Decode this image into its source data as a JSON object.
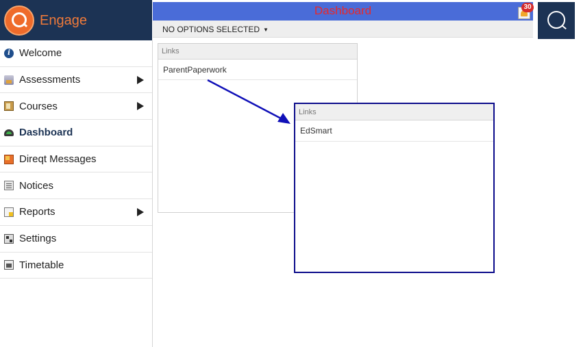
{
  "app": {
    "name": "Engage"
  },
  "sidebar": {
    "items": [
      {
        "label": "Welcome",
        "icon": "info-icon",
        "has_submenu": false,
        "active": false
      },
      {
        "label": "Assessments",
        "icon": "assessments-icon",
        "has_submenu": true,
        "active": false
      },
      {
        "label": "Courses",
        "icon": "courses-icon",
        "has_submenu": true,
        "active": false
      },
      {
        "label": "Dashboard",
        "icon": "dashboard-icon",
        "has_submenu": false,
        "active": true
      },
      {
        "label": "Direqt Messages",
        "icon": "messages-icon",
        "has_submenu": false,
        "active": false
      },
      {
        "label": "Notices",
        "icon": "notices-icon",
        "has_submenu": false,
        "active": false
      },
      {
        "label": "Reports",
        "icon": "reports-icon",
        "has_submenu": true,
        "active": false
      },
      {
        "label": "Settings",
        "icon": "settings-icon",
        "has_submenu": false,
        "active": false
      },
      {
        "label": "Timetable",
        "icon": "timetable-icon",
        "has_submenu": false,
        "active": false
      }
    ]
  },
  "header": {
    "title": "Dashboard",
    "notification_count": "30",
    "title_color": "#e8282a",
    "bar_color": "#4a6cd8"
  },
  "options": {
    "selected_label": "NO OPTIONS SELECTED"
  },
  "widgets": [
    {
      "header": "Links",
      "links": [
        "ParentPaperwork"
      ]
    },
    {
      "header": "Links",
      "links": [
        "EdSmart"
      ]
    }
  ],
  "colors": {
    "brand_navy": "#1c3354",
    "brand_orange": "#ef6b2b",
    "highlight_border": "#0a0a8a",
    "annotation_arrow": "#1010b8"
  }
}
